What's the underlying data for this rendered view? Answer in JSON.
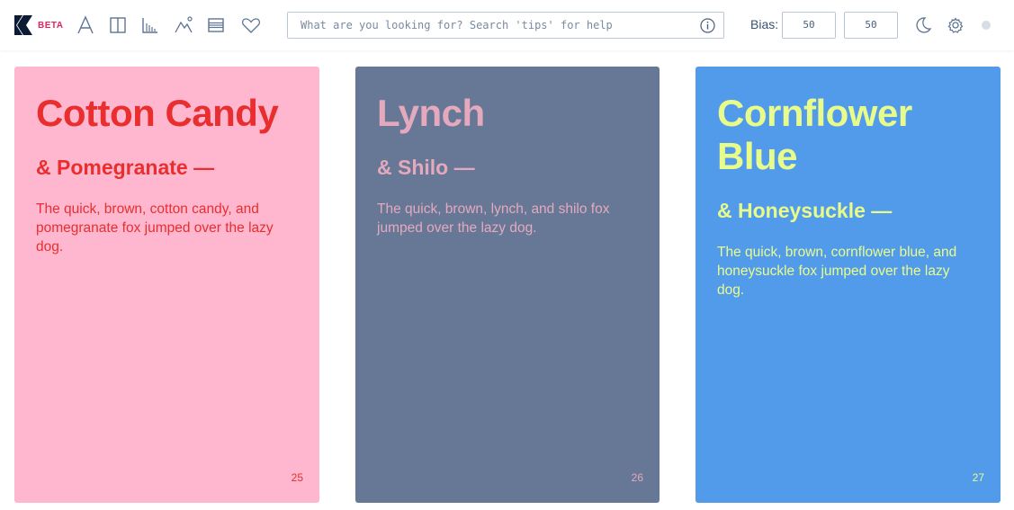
{
  "colors": {
    "brand": "#0b1b33",
    "accent_beta": "#e0245e",
    "icon_stroke": "#5d7593",
    "bias_label": "#3b5272"
  },
  "header": {
    "beta_label": "BETA",
    "tools": [
      {
        "icon": "font-icon"
      },
      {
        "icon": "columns-icon"
      },
      {
        "icon": "bar-chart-icon"
      },
      {
        "icon": "shapes-icon"
      },
      {
        "icon": "list-icon"
      },
      {
        "icon": "heart-icon"
      }
    ],
    "search": {
      "placeholder": "What are you looking for? Search 'tips' for help",
      "value": ""
    },
    "bias": {
      "label": "Bias:",
      "left": "50",
      "right": "50"
    },
    "right_icons": [
      "moon-icon",
      "gear-icon"
    ]
  },
  "cards": [
    {
      "title": "Cotton Candy",
      "subtitle": "& Pomegranate —",
      "text": "The quick, brown, cotton candy, and pomegranate fox jumped over the lazy dog.",
      "number": "25",
      "bg": "#ffb7d0",
      "fg": "#e82e2e"
    },
    {
      "title": "Lynch",
      "subtitle": "& Shilo —",
      "text": "The quick, brown, lynch, and shilo fox jumped over the lazy dog.",
      "number": "26",
      "bg": "#667896",
      "fg": "#e5a9bd"
    },
    {
      "title": "Cornflower Blue",
      "subtitle": "& Honeysuckle —",
      "text": "The quick, brown, cornflower blue, and honeysuckle fox jumped over the lazy dog.",
      "number": "27",
      "bg": "#529bea",
      "fg": "#e8fc8c"
    }
  ]
}
